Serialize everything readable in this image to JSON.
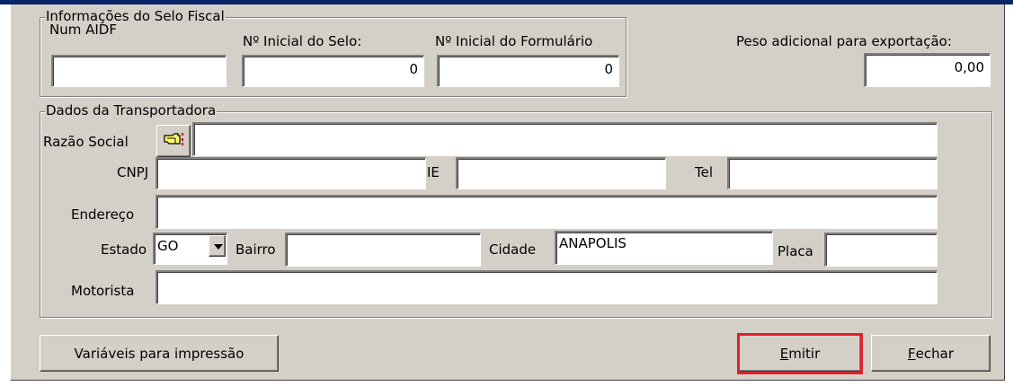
{
  "selo_fiscal": {
    "title": "Informações do Selo Fiscal",
    "num_aidf_label": "Num AIDF",
    "num_aidf_value": "",
    "inicial_selo_label": "Nº Inicial do Selo:",
    "inicial_selo_value": "0",
    "inicial_formulario_label": "Nº Inicial do Formulário",
    "inicial_formulario_value": "0"
  },
  "peso": {
    "label": "Peso adicional para exportação:",
    "value": "0,00"
  },
  "transportadora": {
    "title": "Dados da Transportadora",
    "razao_social_label": "Razão Social",
    "razao_social_value": "",
    "cnpj_label": "CNPJ",
    "cnpj_value": "",
    "ie_label": "IE",
    "ie_value": "",
    "tel_label": "Tel",
    "tel_value": "",
    "endereco_label": "Endereço",
    "endereco_value": "",
    "estado_label": "Estado",
    "estado_value": "GO",
    "bairro_label": "Bairro",
    "bairro_value": "",
    "cidade_label": "Cidade",
    "cidade_value": "ANAPOLIS",
    "placa_label": "Placa",
    "placa_value": "",
    "motorista_label": "Motorista",
    "motorista_value": ""
  },
  "buttons": {
    "variaveis": "Variáveis para impressão",
    "emitir_hotkey": "E",
    "emitir_rest": "mitir",
    "fechar_hotkey": "F",
    "fechar_rest": "echar"
  },
  "colors": {
    "panel": "#d4d0c8",
    "title_bar": "#0a246a",
    "highlight": "#e0202a"
  },
  "icons": {
    "lookup": "pointing-hand-icon"
  }
}
